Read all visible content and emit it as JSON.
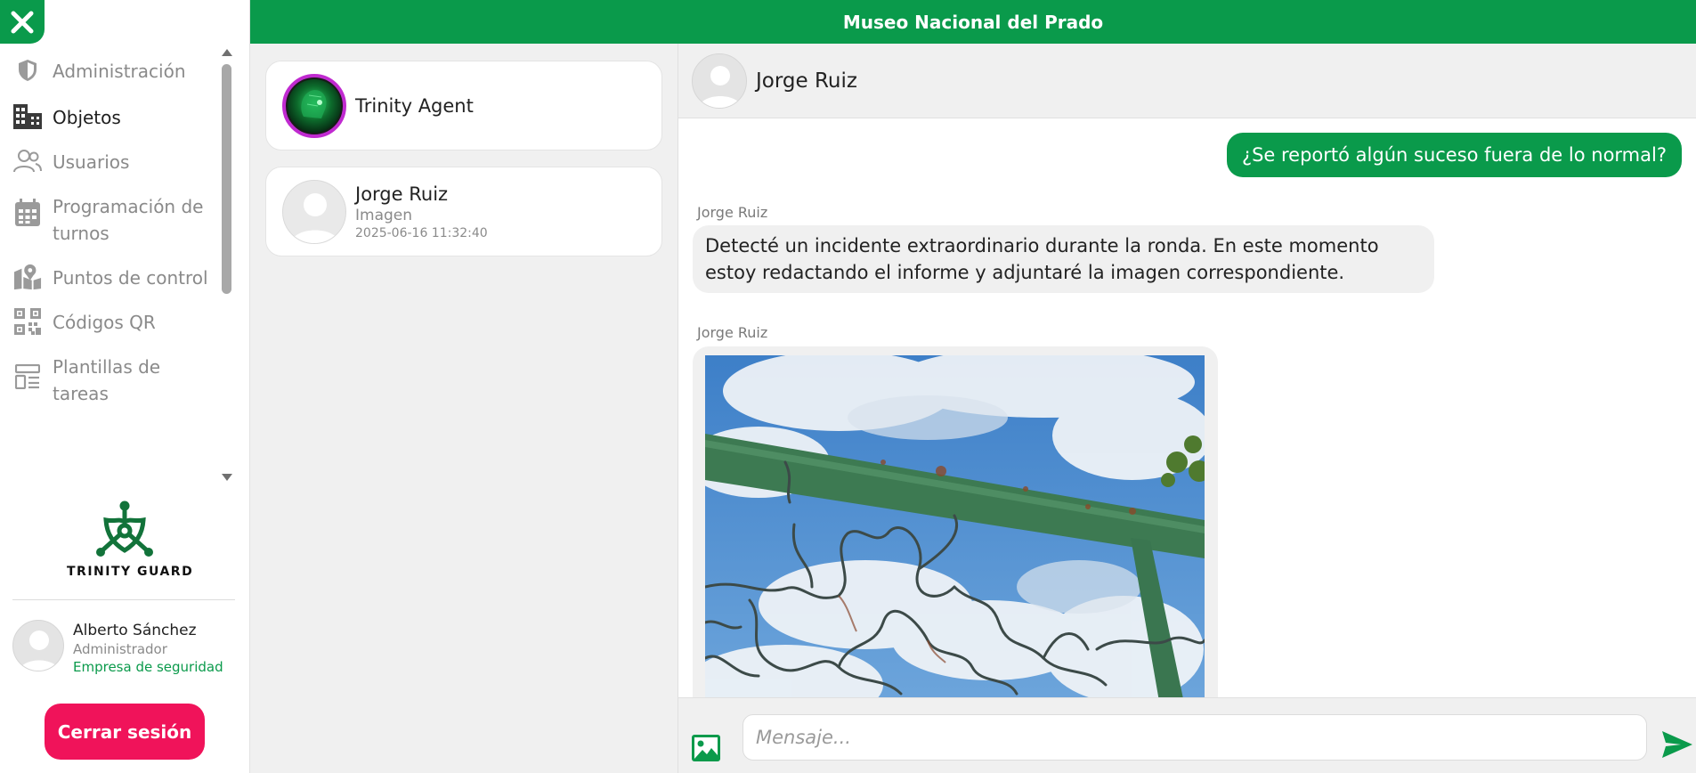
{
  "header": {
    "title": "Museo Nacional del Prado"
  },
  "sidebar": {
    "items": [
      {
        "label": "Administración",
        "icon": "shield-icon"
      },
      {
        "label": "Objetos",
        "icon": "building-icon"
      },
      {
        "label": "Usuarios",
        "icon": "users-icon"
      },
      {
        "label": "Programación de turnos",
        "icon": "calendar-icon"
      },
      {
        "label": "Puntos de control",
        "icon": "map-pin-icon"
      },
      {
        "label": "Códigos QR",
        "icon": "qr-code-icon"
      },
      {
        "label": "Plantillas de tareas",
        "icon": "template-icon"
      }
    ],
    "active_index": 1,
    "logo_text": "TRINITY GUARD",
    "user": {
      "name": "Alberto Sánchez",
      "role": "Administrador",
      "company": "Empresa de seguridad"
    },
    "logout_label": "Cerrar sesión"
  },
  "chat_list": [
    {
      "name": "Trinity Agent"
    },
    {
      "name": "Jorge Ruiz",
      "last_message": "Imagen",
      "timestamp": "2025-06-16 11:32:40"
    }
  ],
  "conversation": {
    "contact_name": "Jorge Ruiz",
    "messages": [
      {
        "direction": "out",
        "text": "¿Se reportó algún suceso fuera de lo normal?"
      },
      {
        "direction": "in",
        "sender": "Jorge Ruiz",
        "text": "Detecté un incidente extraordinario durante la ronda. En este momento estoy redactando el informe y adjuntaré la imagen correspondiente."
      },
      {
        "direction": "in",
        "sender": "Jorge Ruiz",
        "type": "image"
      }
    ],
    "input": {
      "value": "",
      "placeholder": "Mensaje..."
    }
  },
  "colors": {
    "brand": "#0a9a4b",
    "logout": "#f0135a",
    "muted": "#8a8a8a"
  }
}
